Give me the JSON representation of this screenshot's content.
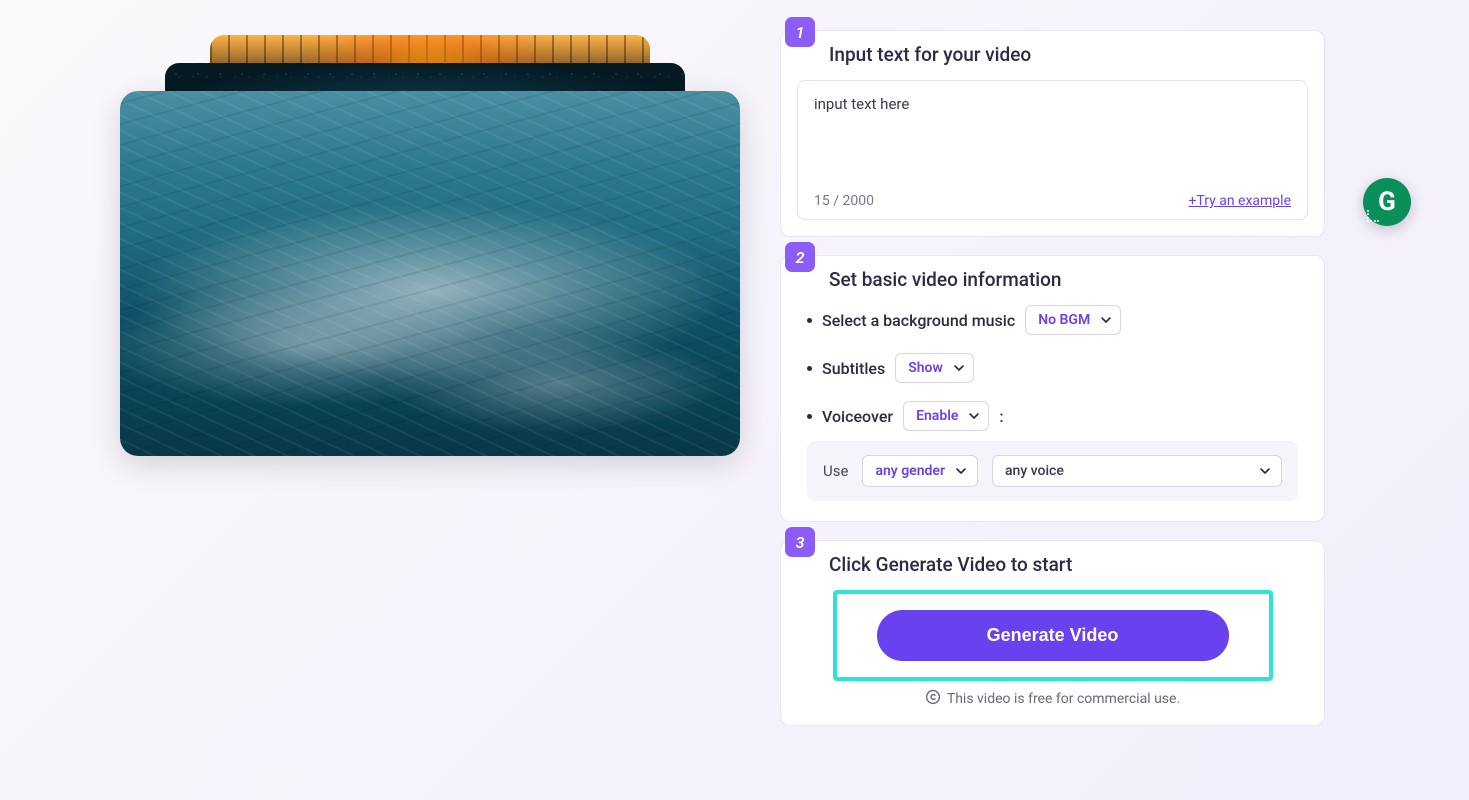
{
  "step1": {
    "number": "1",
    "title": "Input text for your video",
    "textarea_value": "input text here",
    "char_count": "15 / 2000",
    "try_example": "+Try an example"
  },
  "step2": {
    "number": "2",
    "title": "Set basic video information",
    "bgm_label": "Select a background music",
    "bgm_value": "No BGM",
    "subtitles_label": "Subtitles",
    "subtitles_value": "Show",
    "voiceover_label": "Voiceover",
    "voiceover_value": "Enable",
    "use_label": "Use",
    "gender_value": "any gender",
    "voice_value": "any voice"
  },
  "step3": {
    "number": "3",
    "title": "Click Generate Video to start",
    "button": "Generate Video",
    "note": "This video is free for commercial use."
  },
  "floating": {
    "letter": "G"
  }
}
